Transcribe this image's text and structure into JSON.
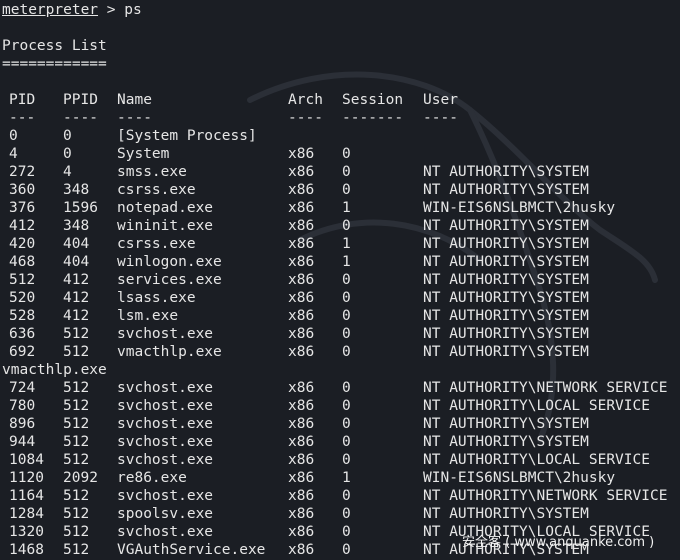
{
  "prompt": {
    "name": "meterpreter",
    "rest": " > ps"
  },
  "heading": "Process List",
  "heading_rule": "============",
  "columns": [
    "PID",
    "PPID",
    "Name",
    "Arch",
    "Session",
    "User"
  ],
  "separators": [
    "---",
    "----",
    "----",
    "----",
    "-------",
    "----"
  ],
  "processes": [
    {
      "pid": "0",
      "ppid": "0",
      "name": "[System Process]",
      "arch": "",
      "session": "",
      "user": ""
    },
    {
      "pid": "4",
      "ppid": "0",
      "name": "System",
      "arch": "x86",
      "session": "0",
      "user": ""
    },
    {
      "pid": "272",
      "ppid": "4",
      "name": "smss.exe",
      "arch": "x86",
      "session": "0",
      "user": "NT AUTHORITY\\SYSTEM"
    },
    {
      "pid": "360",
      "ppid": "348",
      "name": "csrss.exe",
      "arch": "x86",
      "session": "0",
      "user": "NT AUTHORITY\\SYSTEM"
    },
    {
      "pid": "376",
      "ppid": "1596",
      "name": "notepad.exe",
      "arch": "x86",
      "session": "1",
      "user": "WIN-EIS6NSLBMCT\\2husky"
    },
    {
      "pid": "412",
      "ppid": "348",
      "name": "wininit.exe",
      "arch": "x86",
      "session": "0",
      "user": "NT AUTHORITY\\SYSTEM"
    },
    {
      "pid": "420",
      "ppid": "404",
      "name": "csrss.exe",
      "arch": "x86",
      "session": "1",
      "user": "NT AUTHORITY\\SYSTEM"
    },
    {
      "pid": "468",
      "ppid": "404",
      "name": "winlogon.exe",
      "arch": "x86",
      "session": "1",
      "user": "NT AUTHORITY\\SYSTEM"
    },
    {
      "pid": "512",
      "ppid": "412",
      "name": "services.exe",
      "arch": "x86",
      "session": "0",
      "user": "NT AUTHORITY\\SYSTEM"
    },
    {
      "pid": "520",
      "ppid": "412",
      "name": "lsass.exe",
      "arch": "x86",
      "session": "0",
      "user": "NT AUTHORITY\\SYSTEM"
    },
    {
      "pid": "528",
      "ppid": "412",
      "name": "lsm.exe",
      "arch": "x86",
      "session": "0",
      "user": "NT AUTHORITY\\SYSTEM"
    },
    {
      "pid": "636",
      "ppid": "512",
      "name": "svchost.exe",
      "arch": "x86",
      "session": "0",
      "user": "NT AUTHORITY\\SYSTEM"
    },
    {
      "pid": "692",
      "ppid": "512",
      "name": "vmacthlp.exe",
      "arch": "x86",
      "session": "0",
      "user": "NT AUTHORITY\\SYSTEM",
      "wrap": "vmacthlp.exe"
    },
    {
      "pid": "724",
      "ppid": "512",
      "name": "svchost.exe",
      "arch": "x86",
      "session": "0",
      "user": "NT AUTHORITY\\NETWORK SERVICE"
    },
    {
      "pid": "780",
      "ppid": "512",
      "name": "svchost.exe",
      "arch": "x86",
      "session": "0",
      "user": "NT AUTHORITY\\LOCAL SERVICE"
    },
    {
      "pid": "896",
      "ppid": "512",
      "name": "svchost.exe",
      "arch": "x86",
      "session": "0",
      "user": "NT AUTHORITY\\SYSTEM"
    },
    {
      "pid": "944",
      "ppid": "512",
      "name": "svchost.exe",
      "arch": "x86",
      "session": "0",
      "user": "NT AUTHORITY\\SYSTEM"
    },
    {
      "pid": "1084",
      "ppid": "512",
      "name": "svchost.exe",
      "arch": "x86",
      "session": "0",
      "user": "NT AUTHORITY\\LOCAL SERVICE"
    },
    {
      "pid": "1120",
      "ppid": "2092",
      "name": "re86.exe",
      "arch": "x86",
      "session": "1",
      "user": "WIN-EIS6NSLBMCT\\2husky"
    },
    {
      "pid": "1164",
      "ppid": "512",
      "name": "svchost.exe",
      "arch": "x86",
      "session": "0",
      "user": "NT AUTHORITY\\NETWORK SERVICE"
    },
    {
      "pid": "1284",
      "ppid": "512",
      "name": "spoolsv.exe",
      "arch": "x86",
      "session": "0",
      "user": "NT AUTHORITY\\SYSTEM"
    },
    {
      "pid": "1320",
      "ppid": "512",
      "name": "svchost.exe",
      "arch": "x86",
      "session": "0",
      "user": "NT AUTHORITY\\LOCAL SERVICE"
    },
    {
      "pid": "1468",
      "ppid": "512",
      "name": "VGAuthService.exe",
      "arch": "x86",
      "session": "0",
      "user": "NT AUTHORITY\\SYSTEM"
    }
  ],
  "watermark": "安全客 ( www.anquanke.com )",
  "colors": {
    "background": "#1b1e24",
    "text": "#e6e6e6",
    "dragon": "#2a2e36"
  }
}
